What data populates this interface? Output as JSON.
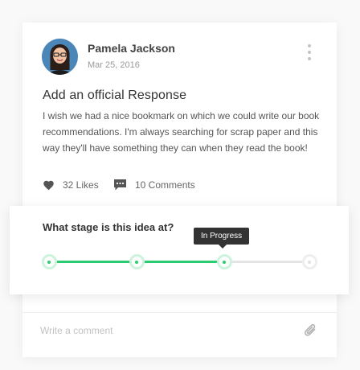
{
  "post": {
    "author": {
      "name": "Pamela Jackson",
      "date": "Mar 25, 2016"
    },
    "title": "Add an official Response",
    "body": "I wish we had a nice bookmark on which we could write our book recommendations. I'm always searching for scrap paper and this way they'll have something they can when they read the book!",
    "stats": {
      "likes_label": "32 Likes",
      "comments_label": "10 Comments"
    },
    "icons": {
      "avatar": "avatar-photo",
      "more": "more-vertical-icon",
      "likes": "heart-icon",
      "comments": "comment-bubble-icon",
      "attach": "paperclip-icon"
    }
  },
  "stage": {
    "question": "What stage is this idea at?",
    "tooltip": "In Progress",
    "steps_total": 4,
    "current_step": 3
  },
  "comment": {
    "placeholder": "Write a comment"
  },
  "colors": {
    "accent": "#2ecc71",
    "tooltip_bg": "#333333",
    "text_dark": "#333333",
    "text_muted": "#999999"
  }
}
